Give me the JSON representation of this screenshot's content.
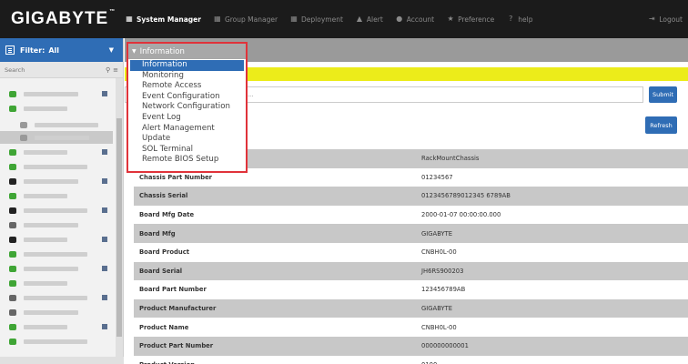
{
  "header": {
    "logo": "GIGABYTE",
    "logo_tm": "™",
    "nav": [
      {
        "label": "System Manager",
        "icon": "grid-icon",
        "active": true
      },
      {
        "label": "Group Manager",
        "icon": "grid-icon",
        "active": false
      },
      {
        "label": "Deployment",
        "icon": "grid-icon",
        "active": false
      },
      {
        "label": "Alert",
        "icon": "warning-icon",
        "active": false
      },
      {
        "label": "Account",
        "icon": "user-icon",
        "active": false
      },
      {
        "label": "Preference",
        "icon": "star-icon",
        "active": false
      },
      {
        "label": "help",
        "icon": "question-icon",
        "active": false
      }
    ],
    "logout": "Logout"
  },
  "sidebar": {
    "filter_label": "Filter:",
    "filter_value": "All",
    "search_placeholder": "Search",
    "node_statuses": [
      "ok",
      "ok",
      "sq",
      "sq",
      "ok",
      "ok",
      "err",
      "ok",
      "err",
      "unk",
      "err",
      "ok",
      "ok",
      "ok",
      "unk",
      "unk",
      "ok",
      "ok"
    ]
  },
  "menu": {
    "header": "Information",
    "items": [
      {
        "label": "Information",
        "active": true
      },
      {
        "label": "Monitoring",
        "active": false
      },
      {
        "label": "Remote Access",
        "active": false
      },
      {
        "label": "Event Configuration",
        "active": false
      },
      {
        "label": "Network Configuration",
        "active": false
      },
      {
        "label": "Event Log",
        "active": false
      },
      {
        "label": "Alert Management",
        "active": false
      },
      {
        "label": "Update",
        "active": false
      },
      {
        "label": "SOL Terminal",
        "active": false
      },
      {
        "label": "Remote BIOS Setup",
        "active": false
      }
    ]
  },
  "main": {
    "command_placeholder": "n...",
    "submit_label": "Submit",
    "refresh_label": "Refresh",
    "rows": [
      {
        "key": "",
        "value": "RackMountChassis"
      },
      {
        "key": "Chassis Part Number",
        "value": "01234567"
      },
      {
        "key": "Chassis Serial",
        "value": "0123456789012345 6789AB"
      },
      {
        "key": "Board Mfg Date",
        "value": "2000-01-07 00:00:00.000"
      },
      {
        "key": "Board Mfg",
        "value": "GIGABYTE"
      },
      {
        "key": "Board Product",
        "value": "CNBH0L-00"
      },
      {
        "key": "Board Serial",
        "value": "JH6RS900203"
      },
      {
        "key": "Board Part Number",
        "value": "123456789AB"
      },
      {
        "key": "Product Manufacturer",
        "value": "GIGABYTE"
      },
      {
        "key": "Product Name",
        "value": "CNBH0L-00"
      },
      {
        "key": "Product Part Number",
        "value": "000000000001"
      },
      {
        "key": "Product Version",
        "value": "0100"
      }
    ]
  },
  "colors": {
    "accent": "#2f6db5",
    "alert_bar": "#ecec1a",
    "highlight_border": "#e0333a",
    "topbar": "#1b1b1b"
  }
}
